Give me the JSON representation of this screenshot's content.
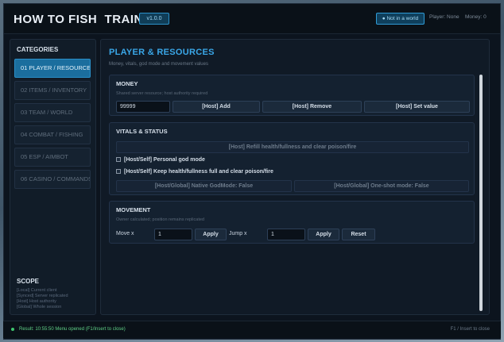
{
  "header": {
    "title": "HOW TO FISH  TRAINER",
    "version": "v1.0.0",
    "world_status": "● Not in a world",
    "player": "Player: None",
    "money": "Money: 0"
  },
  "sidebar": {
    "title": "CATEGORIES",
    "items": [
      {
        "label": "01   PLAYER / RESOURCES"
      },
      {
        "label": "02   ITEMS / INVENTORY"
      },
      {
        "label": "03   TEAM / WORLD"
      },
      {
        "label": "04   COMBAT / FISHING"
      },
      {
        "label": "05   ESP / AIMBOT"
      },
      {
        "label": "06   CASINO / COMMANDS"
      }
    ],
    "scope_title": "SCOPE",
    "scope_lines": [
      "[Local] Current client",
      "[Synced] Server replicated",
      "[Host] Host authority",
      "[Global] Whole session"
    ]
  },
  "main": {
    "title": "PLAYER & RESOURCES",
    "subtitle": "Money, vitals, god mode and movement values",
    "money": {
      "title": "MONEY",
      "note": "Shared server resource; host authority required",
      "value": "99999",
      "add_label": "[Host] Add",
      "remove_label": "[Host] Remove",
      "set_label": "[Host] Set value"
    },
    "vitals": {
      "title": "VITALS & STATUS",
      "refill_label": "[Host] Refill health/fullness and clear poison/fire",
      "godmode_label": "[Host/Self] Personal god mode",
      "keepfull_label": "[Host/Self] Keep health/fullness full and clear poison/fire",
      "native_godmode_label": "[Host/Global] Native GodMode: False",
      "oneshot_label": "[Host/Global] One-shot mode: False"
    },
    "movement": {
      "title": "MOVEMENT",
      "note": "Owner calculated; position remains replicated",
      "move_label": "Move x",
      "move_value": "1",
      "apply_label": "Apply",
      "jump_label": "Jump x",
      "jump_value": "1",
      "reset_label": "Reset"
    }
  },
  "footer": {
    "status": "Result: 10:55:50  Menu opened (F1/Insert to close)",
    "hint": "F1 / Insert to close"
  },
  "colors": {
    "accent": "#3aa7e8",
    "active_tab": "#1b6e9e",
    "status_ok": "#5fcf86"
  }
}
